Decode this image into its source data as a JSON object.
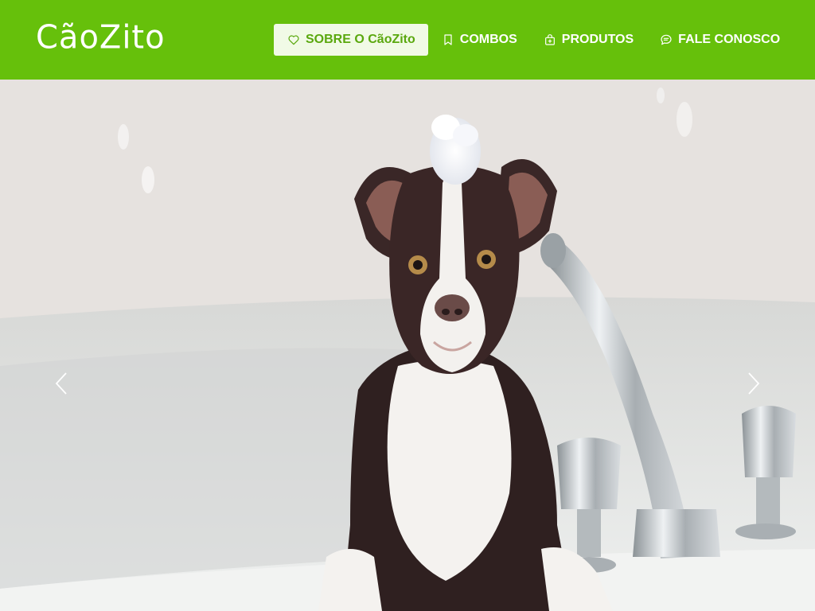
{
  "brand": {
    "logo_text": "CãoZito"
  },
  "nav": {
    "items": [
      {
        "label": "SOBRE O CãoZito",
        "icon": "heart-icon",
        "active": true
      },
      {
        "label": "COMBOS",
        "icon": "bookmark-icon",
        "active": false
      },
      {
        "label": "PRODUTOS",
        "icon": "bag-icon",
        "active": false
      },
      {
        "label": "FALE CONOSCO",
        "icon": "chat-icon",
        "active": false
      }
    ]
  },
  "carousel": {
    "prev_icon": "chevron-left-icon",
    "next_icon": "chevron-right-icon",
    "slide_image": "dog-in-bathtub-photo"
  },
  "colors": {
    "header_bg": "#66c00b",
    "active_bg": "#f1fae6",
    "active_text": "#5aa80e",
    "nav_text": "#ffffff"
  }
}
